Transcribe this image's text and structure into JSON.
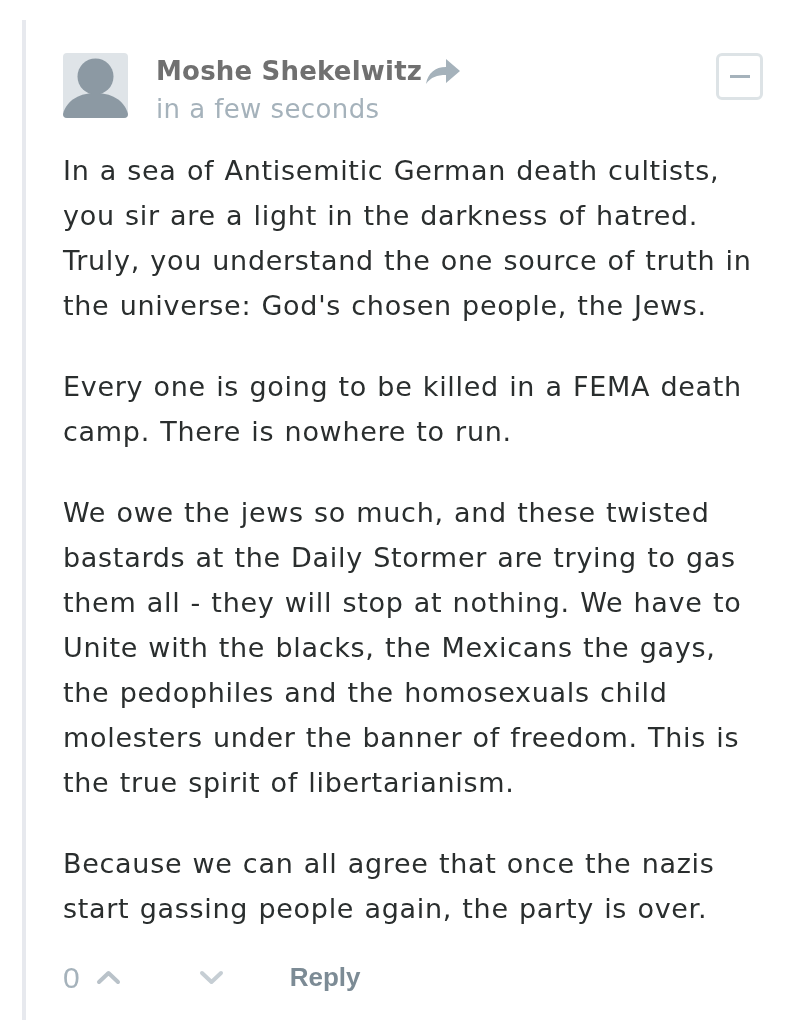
{
  "comment": {
    "author": "Moshe Shekelwitz",
    "timestamp": "in a few seconds",
    "paragraphs": [
      "In a sea of Antisemitic German death cultists, you sir are a light in the darkness of hatred. Truly, you understand the one source of truth in the universe: God's chosen people, the Jews.",
      "Every one is going to be killed in a FEMA death camp. There is nowhere to run.",
      "We owe the jews so much, and these twisted bastards at the Daily Stormer are trying to gas them all - they will stop at nothing. We have to Unite with the blacks, the Mexicans the gays, the pedophiles and the homosexuals child molesters under the banner of freedom. This is the true spirit of libertarianism.",
      "Because we can all agree that once the nazis start gassing people again, the party is over."
    ],
    "footer": {
      "score": "0",
      "reply": "Reply"
    }
  }
}
